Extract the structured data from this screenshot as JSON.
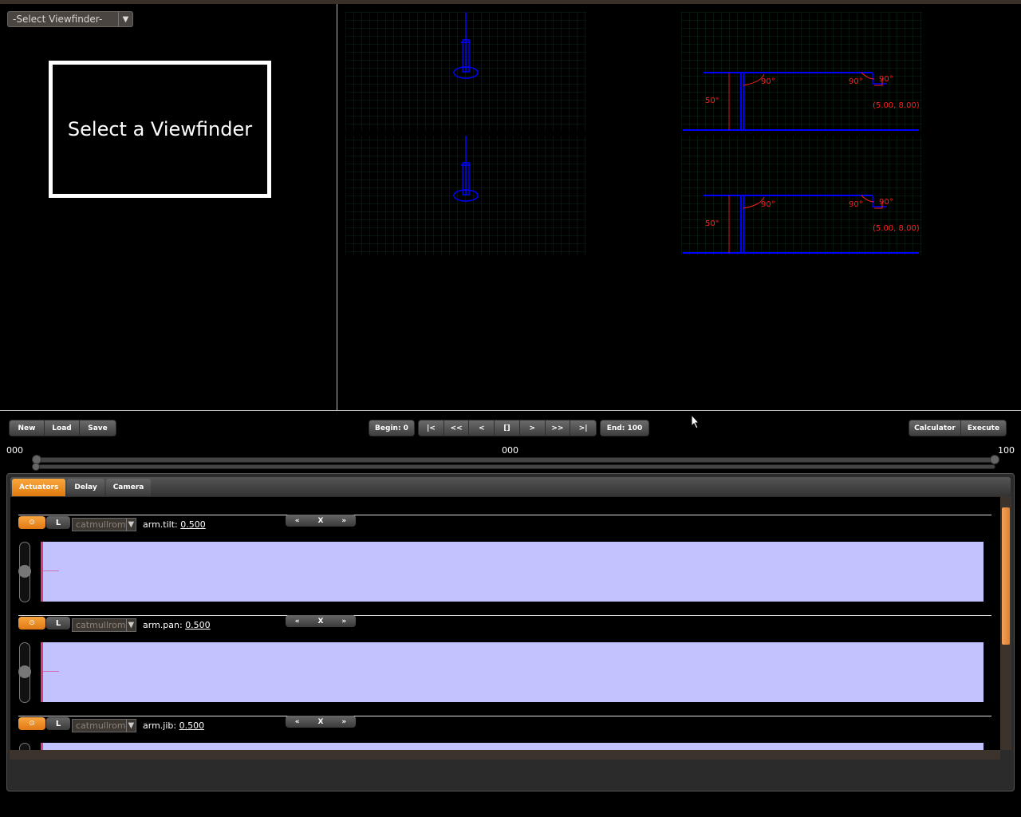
{
  "viewfinder": {
    "select_value": "-Select Viewfinder-",
    "placeholder_text": "Select a Viewfinder"
  },
  "diagrams": {
    "angle_label": "90°",
    "height_label": "50\"",
    "coord_label": "(5.00, 8.00)"
  },
  "toolbar": {
    "file_buttons": [
      "New",
      "Load",
      "Save"
    ],
    "begin_label": "Begin: 0",
    "transport_buttons": [
      "|<",
      "<<",
      "<",
      "[]",
      ">",
      ">>",
      ">|"
    ],
    "end_label": "End: 100",
    "right_buttons": [
      "Calculator",
      "Execute"
    ]
  },
  "timeline": {
    "left_label": "000",
    "center_label": "000",
    "right_label": "100",
    "slider_begin": 0,
    "slider_end": 100
  },
  "tabs": {
    "items": [
      "Actuators",
      "Delay",
      "Camera"
    ],
    "active": "Actuators"
  },
  "actuators": [
    {
      "toggle": "⊙",
      "lock": "L",
      "interp": "catmullrom",
      "name": "arm.tilt:",
      "value": "0.500",
      "nav": [
        "«",
        "X",
        "»"
      ]
    },
    {
      "toggle": "⊙",
      "lock": "L",
      "interp": "catmullrom",
      "name": "arm.pan:",
      "value": "0.500",
      "nav": [
        "«",
        "X",
        "»"
      ]
    },
    {
      "toggle": "⊙",
      "lock": "L",
      "interp": "catmullrom",
      "name": "arm.jib:",
      "value": "0.500",
      "nav": [
        "«",
        "X",
        "»"
      ]
    }
  ],
  "colors": {
    "accent_orange": "#f39a2e",
    "graph_fill": "#c2c2ff",
    "diagram_blue": "#0000ff",
    "diagram_red": "#ff2020"
  }
}
